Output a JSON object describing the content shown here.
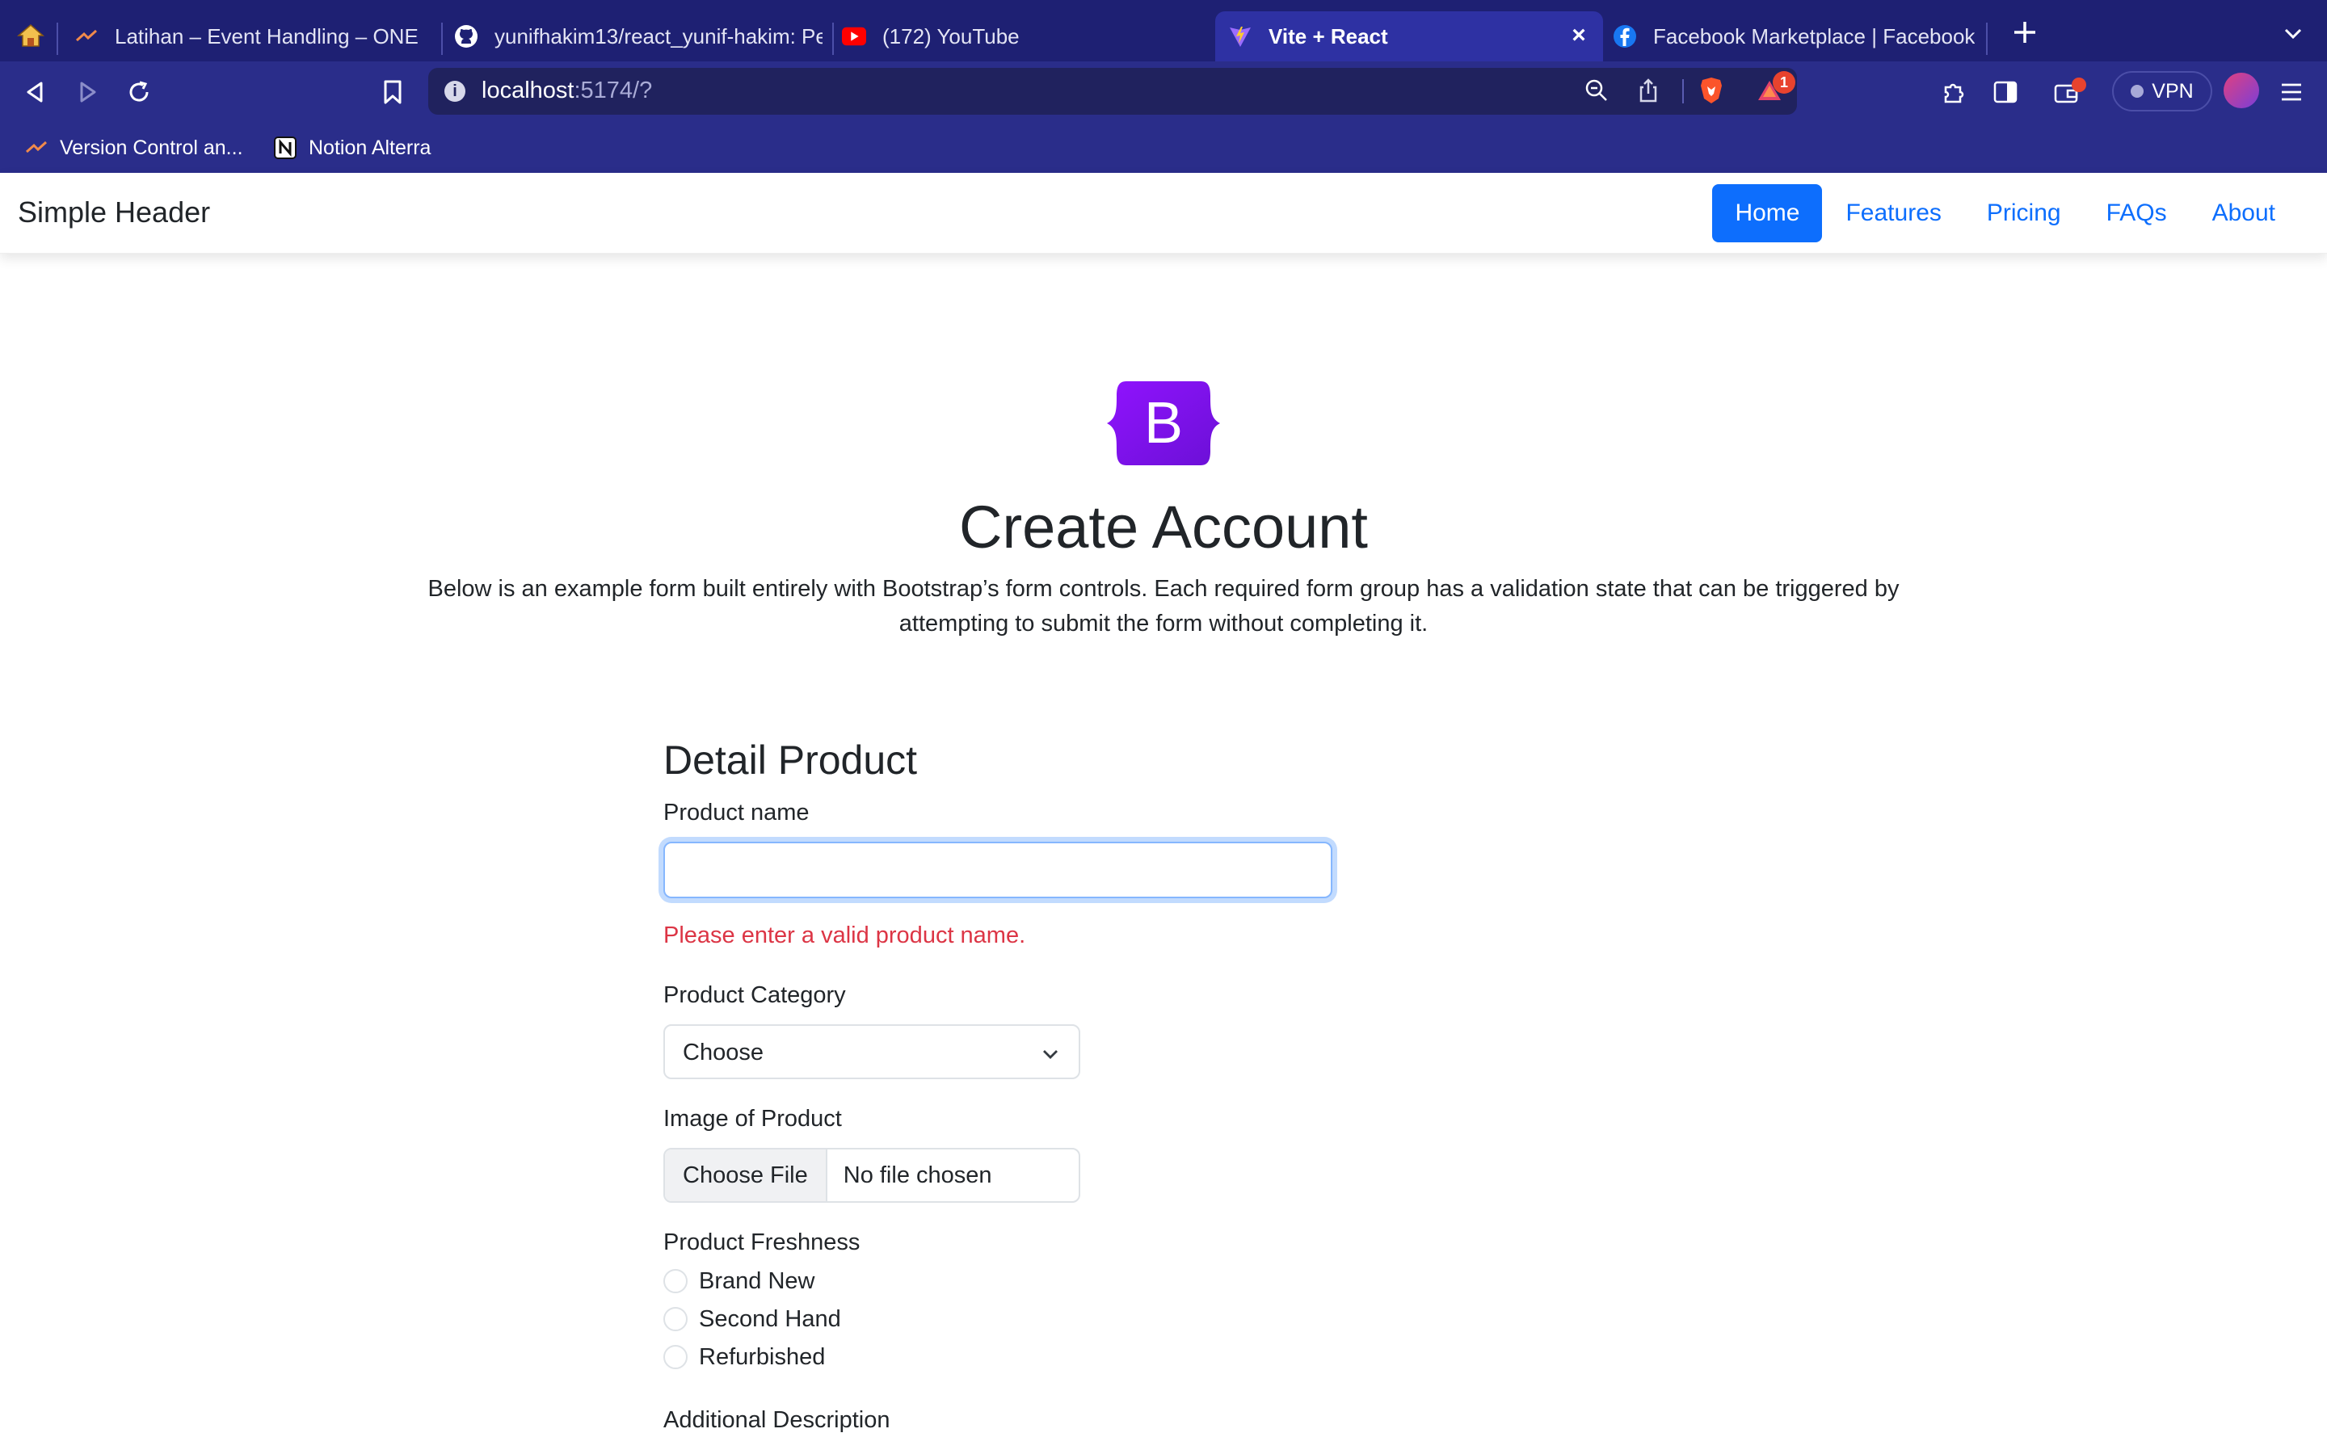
{
  "browser": {
    "tabs": [
      {
        "title": "Latihan – Event Handling – ONE by",
        "active": false
      },
      {
        "title": "yunifhakim13/react_yunif-hakim: Pe",
        "active": false
      },
      {
        "title": "(172) YouTube",
        "active": false
      },
      {
        "title": "Vite + React",
        "active": true
      },
      {
        "title": "Facebook Marketplace | Facebook",
        "active": false
      }
    ],
    "url": {
      "host": "localhost",
      "rest": ":5174/?"
    },
    "vpn_label": "VPN",
    "notification_count": "1",
    "bookmarks": [
      {
        "label": "Version Control an..."
      },
      {
        "label": "Notion Alterra"
      }
    ]
  },
  "navbar": {
    "brand": "Simple Header",
    "links": [
      {
        "label": "Home",
        "active": true
      },
      {
        "label": "Features"
      },
      {
        "label": "Pricing"
      },
      {
        "label": "FAQs"
      },
      {
        "label": "About"
      }
    ]
  },
  "hero": {
    "logo_letter": "B",
    "title": "Create Account",
    "lead": "Below is an example form built entirely with Bootstrap’s form controls. Each required form group has a validation state that can be triggered by attempting to submit the form without completing it."
  },
  "form": {
    "section_title": "Detail Product",
    "product_name": {
      "label": "Product name",
      "value": "",
      "error": "Please enter a valid product name."
    },
    "category": {
      "label": "Product Category",
      "selected": "Choose"
    },
    "image": {
      "label": "Image of Product",
      "button": "Choose File",
      "status": "No file chosen"
    },
    "freshness": {
      "label": "Product Freshness",
      "options": [
        "Brand New",
        "Second Hand",
        "Refurbished"
      ]
    },
    "description": {
      "label": "Additional Description"
    }
  },
  "colors": {
    "primary": "#0d6efd",
    "danger": "#dc3545",
    "bootstrap_purple": "#712cf9",
    "chrome": "#2a2d8a"
  }
}
